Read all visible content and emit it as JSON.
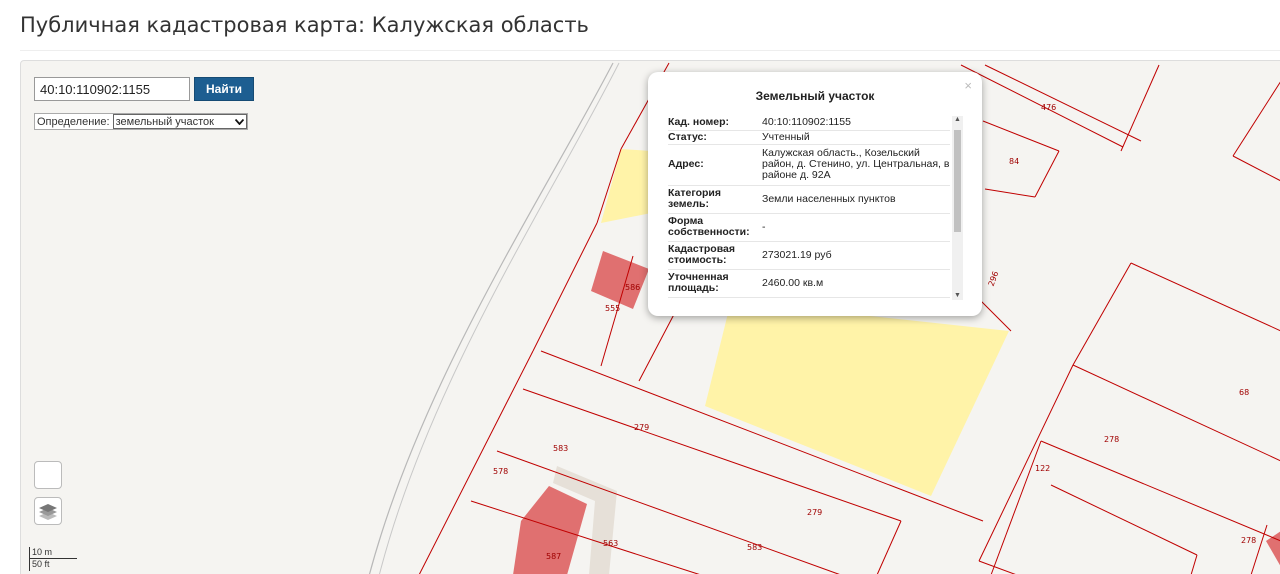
{
  "page": {
    "title": "Публичная кадастровая карта: Калужская область"
  },
  "search": {
    "value": "40:10:110902:1155",
    "button_label": "Найти"
  },
  "definition": {
    "label": "Определение:",
    "selected": "земельный участок"
  },
  "popup": {
    "title": "Земельный участок",
    "close_glyph": "×",
    "rows": [
      {
        "key": "Кад. номер:",
        "value": "40:10:110902:1155"
      },
      {
        "key": "Статус:",
        "value": "Учтенный"
      },
      {
        "key": "Адрес:",
        "value": "Калужская область., Козельский район, д. Стенино, ул. Центральная, в районе д. 92А"
      },
      {
        "key": "Категория земель:",
        "value": "Земли населенных пунктов"
      },
      {
        "key": "Форма собственности:",
        "value": "-"
      },
      {
        "key": "Кадастровая стоимость:",
        "value": "273021.19 руб"
      },
      {
        "key": "Уточненная площадь:",
        "value": "2460.00 кв.м"
      }
    ]
  },
  "map": {
    "parcel_labels": [
      "476",
      "84",
      "296",
      "586",
      "555",
      "279",
      "583",
      "578",
      "563",
      "587",
      "279",
      "583",
      "68",
      "278",
      "122",
      "278"
    ],
    "colors": {
      "boundary": "#c00000",
      "highlight": "#fff3a8",
      "building": "#e07070",
      "label": "#a00000"
    }
  },
  "scale": {
    "meters": "10 m",
    "feet": "50 ft"
  },
  "icons": {
    "layers": "layers-icon",
    "dropdown": "chevron-down-icon",
    "close": "close-icon"
  }
}
